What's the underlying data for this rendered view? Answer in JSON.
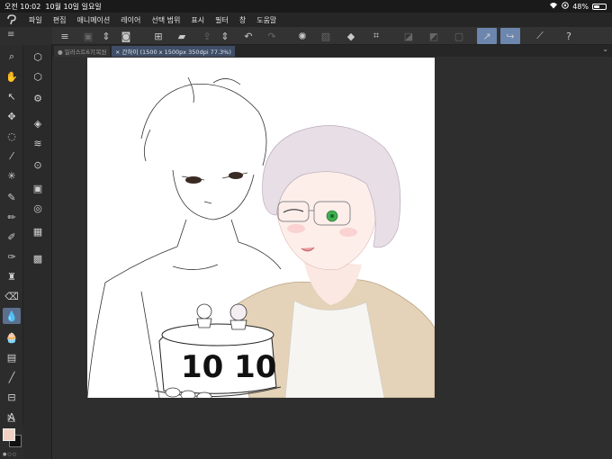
{
  "status": {
    "time": "오전 10:02",
    "date": "10월 10일 일요일",
    "battery": "48%",
    "battery_level": 0.48
  },
  "menu": [
    "파일",
    "편집",
    "애니메이션",
    "레이어",
    "선택 범위",
    "표시",
    "필터",
    "창",
    "도움말"
  ],
  "tabs": [
    {
      "label": "● 일러스트67[복원"
    },
    {
      "label": "× 간하이 (1500 x 1500px 350dpi 77.3%)"
    }
  ],
  "canvas_art": {
    "cake_text": "10 10"
  },
  "colors": {
    "main": "#f3d0c4",
    "sub": "#111111",
    "accent": "#6c86ad"
  }
}
